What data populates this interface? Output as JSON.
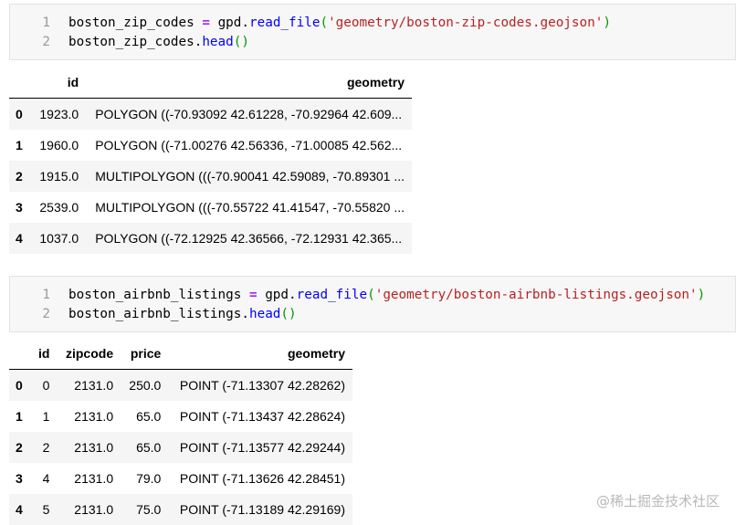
{
  "cell1": {
    "lines": [
      {
        "num": "1",
        "var": "boston_zip_codes",
        "op": "=",
        "obj": "gpd.",
        "fn": "read_file",
        "open": "(",
        "str": "'geometry/boston-zip-codes.geojson'",
        "close": ")"
      },
      {
        "num": "2",
        "var": "boston_zip_codes.",
        "fn": "head",
        "parens": "()"
      }
    ]
  },
  "table1": {
    "columns": [
      "id",
      "geometry"
    ],
    "rows": [
      {
        "index": "0",
        "id": "1923.0",
        "geometry": "POLYGON ((-70.93092 42.61228, -70.92964 42.609..."
      },
      {
        "index": "1",
        "id": "1960.0",
        "geometry": "POLYGON ((-71.00276 42.56336, -71.00085 42.562..."
      },
      {
        "index": "2",
        "id": "1915.0",
        "geometry": "MULTIPOLYGON (((-70.90041 42.59089, -70.89301 ..."
      },
      {
        "index": "3",
        "id": "2539.0",
        "geometry": "MULTIPOLYGON (((-70.55722 41.41547, -70.55820 ..."
      },
      {
        "index": "4",
        "id": "1037.0",
        "geometry": "POLYGON ((-72.12925 42.36566, -72.12931 42.365..."
      }
    ]
  },
  "cell2": {
    "lines": [
      {
        "num": "1",
        "var": "boston_airbnb_listings",
        "op": "=",
        "obj": "gpd.",
        "fn": "read_file",
        "open": "(",
        "str": "'geometry/boston-airbnb-listings.geojson'",
        "close": ")"
      },
      {
        "num": "2",
        "var": "boston_airbnb_listings.",
        "fn": "head",
        "parens": "()"
      }
    ]
  },
  "table2": {
    "columns": [
      "id",
      "zipcode",
      "price",
      "geometry"
    ],
    "rows": [
      {
        "index": "0",
        "id": "0",
        "zipcode": "2131.0",
        "price": "250.0",
        "geometry": "POINT (-71.13307 42.28262)"
      },
      {
        "index": "1",
        "id": "1",
        "zipcode": "2131.0",
        "price": "65.0",
        "geometry": "POINT (-71.13437 42.28624)"
      },
      {
        "index": "2",
        "id": "2",
        "zipcode": "2131.0",
        "price": "65.0",
        "geometry": "POINT (-71.13577 42.29244)"
      },
      {
        "index": "3",
        "id": "4",
        "zipcode": "2131.0",
        "price": "79.0",
        "geometry": "POINT (-71.13626 42.28451)"
      },
      {
        "index": "4",
        "id": "5",
        "zipcode": "2131.0",
        "price": "75.0",
        "geometry": "POINT (-71.13189 42.29169)"
      }
    ]
  },
  "watermark": "@稀土掘金技术社区"
}
